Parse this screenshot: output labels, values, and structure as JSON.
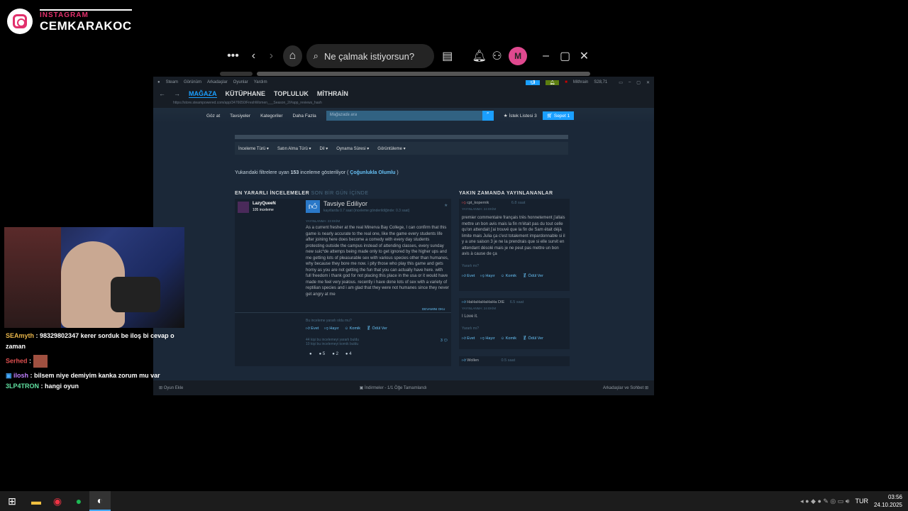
{
  "instagram": {
    "label": "INSTAGRAM",
    "handle": "CEMKARAKOC"
  },
  "topbar": {
    "search_placeholder": "Ne çalmak istiyorsun?",
    "avatar_letter": "M"
  },
  "steam": {
    "menu": [
      "Steam",
      "Görünüm",
      "Arkadaşlar",
      "Oyunlar",
      "Yardım"
    ],
    "account": "Mithrain",
    "wallet": "S28,71",
    "nav": [
      "MAĞAZA",
      "KÜTÜPHANE",
      "TOPLULUK",
      "MİTHRAİN"
    ],
    "url": "https://store.steampowered.com/app/3476650/FreshWomen___Season_2/#app_reviews_hash",
    "store_menu": [
      "Göz at",
      "Tavsiyeler",
      "Kategoriler",
      "Daha Fazla"
    ],
    "store_search_placeholder": "Mağazada ara",
    "wishlist": "İstek Listesi",
    "wishlist_count": "3",
    "cart": "Sepet",
    "cart_count": "1",
    "filters": [
      "İnceleme Türü",
      "Satın Alma Türü",
      "Dil",
      "Oynama Süresi",
      "Görüntüleme"
    ],
    "filter_summary": {
      "before": "Yukarıdaki filtrelere uyan",
      "count": "153",
      "after": "inceleme gösteriliyor (",
      "rating": "Çoğunlukla Olumlu",
      "close": ")"
    },
    "helpful_header": "EN YARARLI İNCELEMELER",
    "helpful_sub": "SON BİR GÜN İÇİNDE",
    "recent_header": "YAKIN ZAMANDA YAYINLANANLAR",
    "main_review": {
      "user": "LazyQueeN",
      "reviews": "105 inceleme",
      "verdict": "Tavsiye Ediliyor",
      "hours": "kayıtlarda 0.7 saat (inceleme gönderildiğinde: 0.3 saat)",
      "posted": "YAYINLANMA: 23 EKİM",
      "text": "As a current fresher at the real Minerva Bay College, I can confirm that this game is nearly accurate to the real one, like the game every students life after joining here does become a comedy with every day students protesting outside the campus instead of attending classes, every sunday new suic*de attemps being made only to get ignored by the higher ups and me getting lots of pleasurable sex with various species other than humanes, why because they bore me now. i pity those who play this game and gets horny as you are not getting the fun that you can actually have here. with full freedom i thank god for not placing this place in the usa or it would have made me feel very jealous. recently i have done lots of sex with a variety of reptilian species and i am glad that they were not humanes since they never get angry at me",
      "read_more": "DEVAMINI OKU",
      "helpful_q": "Bu inceleme yararlı oldu mu?",
      "yes": "Evet",
      "no": "Hayır",
      "funny": "Komik",
      "award": "Ödül Ver",
      "helpful_count": "44 kişi bu incelemeyi yararlı buldu",
      "funny_count": "10 kişi bu incelemeyi komik buldu",
      "comments": "3",
      "awards": [
        "5",
        "2",
        "4"
      ]
    },
    "recent": [
      {
        "user": "cpt_kopernik",
        "hours": "6.8 saat",
        "posted": "YAYINLANMA: 24 EKİM",
        "text": "premier commentaire français très honnetement j'allais mettre un bon avis mais la fin m'était pas du tout celle qu'on attendait j'ai trouvé que la fin de Sam était déjà limite mais Julia ça c'est totalement impardonnable si il y a une saison 3 je ne la prendrais que si elle survit en attendant désolé mais je ne peut pas mettre un bon avis à cause de ça"
      },
      {
        "user": "HaHaHaHaHaHa DIE",
        "hours": "6.5 saat",
        "posted": "YAYINLANMA: 24 EKİM",
        "text": "I Love it."
      },
      {
        "user": "Wollen",
        "hours": "0.5 saat",
        "posted": "",
        "text": ""
      }
    ],
    "helpful_q_short": "Yararlı mı?",
    "footer": {
      "add_game": "Oyun Ekle",
      "downloads": "İndirmeler - 1/1 Öğe Tamamlandı",
      "friends": "Arkadaşlar ve Sohbet"
    }
  },
  "chat": [
    {
      "user": "SEAmyth",
      "color": "#e8b54a",
      "text": "98329802347 kerer sorduk be iloş bi cevap o zaman"
    },
    {
      "user": "Serhed",
      "color": "#e05050",
      "text": ""
    },
    {
      "user": "ilosh",
      "color": "#c080ff",
      "text": "bilsem niye demiyim kanka zorum mu var"
    },
    {
      "user": "3LP4TRON",
      "color": "#60e0a0",
      "text": "hangi oyun"
    }
  ],
  "tray": {
    "lang": "TUR",
    "time": "03:56",
    "date": "24.10.2025"
  }
}
